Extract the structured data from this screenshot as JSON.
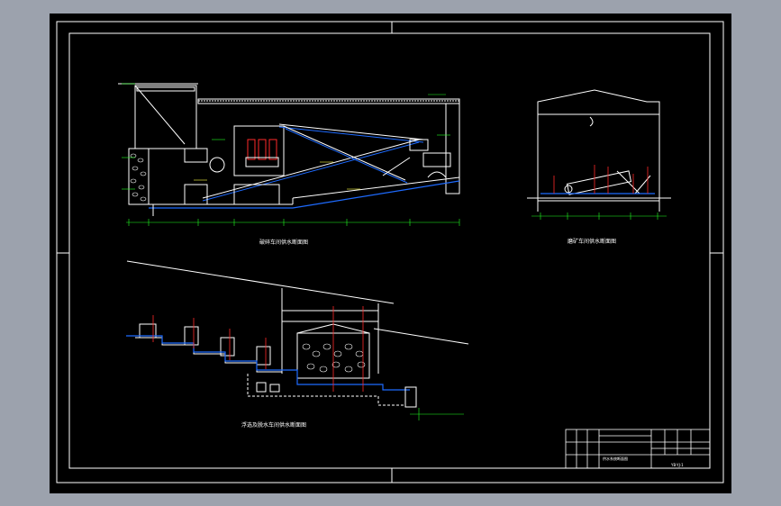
{
  "sheet": {
    "background": "#9ca2ad",
    "paper": "#000000",
    "colors": {
      "line": "#ffffff",
      "pipe_blue": "#1e6bff",
      "pipe_red": "#ff2a2a",
      "dim_green": "#22ff22",
      "note_yellow": "#ffff44"
    }
  },
  "views": [
    {
      "id": "view-1",
      "title": "破碎车间供水断面图"
    },
    {
      "id": "view-2",
      "title": "磨矿车间供水断面图"
    },
    {
      "id": "view-3",
      "title": "浮选及脱水车间供水断面图"
    }
  ],
  "title_block": {
    "drawing_name": "供水系统断面图",
    "drawing_number": "YB-YJ-1"
  }
}
